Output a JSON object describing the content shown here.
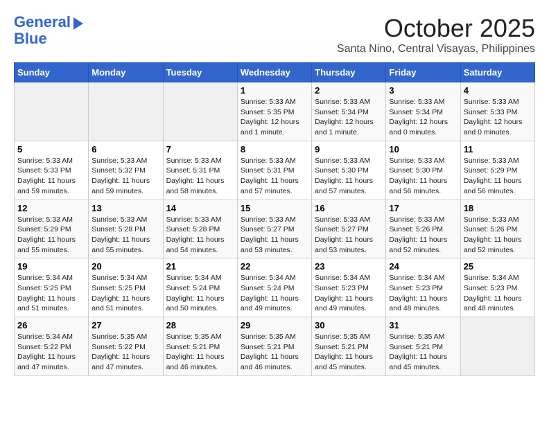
{
  "header": {
    "logo_line1": "General",
    "logo_line2": "Blue",
    "month": "October 2025",
    "location": "Santa Nino, Central Visayas, Philippines"
  },
  "days_of_week": [
    "Sunday",
    "Monday",
    "Tuesday",
    "Wednesday",
    "Thursday",
    "Friday",
    "Saturday"
  ],
  "weeks": [
    [
      {
        "day": "",
        "info": ""
      },
      {
        "day": "",
        "info": ""
      },
      {
        "day": "",
        "info": ""
      },
      {
        "day": "1",
        "info": "Sunrise: 5:33 AM\nSunset: 5:35 PM\nDaylight: 12 hours and 1 minute."
      },
      {
        "day": "2",
        "info": "Sunrise: 5:33 AM\nSunset: 5:34 PM\nDaylight: 12 hours and 1 minute."
      },
      {
        "day": "3",
        "info": "Sunrise: 5:33 AM\nSunset: 5:34 PM\nDaylight: 12 hours and 0 minutes."
      },
      {
        "day": "4",
        "info": "Sunrise: 5:33 AM\nSunset: 5:33 PM\nDaylight: 12 hours and 0 minutes."
      }
    ],
    [
      {
        "day": "5",
        "info": "Sunrise: 5:33 AM\nSunset: 5:33 PM\nDaylight: 11 hours and 59 minutes."
      },
      {
        "day": "6",
        "info": "Sunrise: 5:33 AM\nSunset: 5:32 PM\nDaylight: 11 hours and 59 minutes."
      },
      {
        "day": "7",
        "info": "Sunrise: 5:33 AM\nSunset: 5:31 PM\nDaylight: 11 hours and 58 minutes."
      },
      {
        "day": "8",
        "info": "Sunrise: 5:33 AM\nSunset: 5:31 PM\nDaylight: 11 hours and 57 minutes."
      },
      {
        "day": "9",
        "info": "Sunrise: 5:33 AM\nSunset: 5:30 PM\nDaylight: 11 hours and 57 minutes."
      },
      {
        "day": "10",
        "info": "Sunrise: 5:33 AM\nSunset: 5:30 PM\nDaylight: 11 hours and 56 minutes."
      },
      {
        "day": "11",
        "info": "Sunrise: 5:33 AM\nSunset: 5:29 PM\nDaylight: 11 hours and 56 minutes."
      }
    ],
    [
      {
        "day": "12",
        "info": "Sunrise: 5:33 AM\nSunset: 5:29 PM\nDaylight: 11 hours and 55 minutes."
      },
      {
        "day": "13",
        "info": "Sunrise: 5:33 AM\nSunset: 5:28 PM\nDaylight: 11 hours and 55 minutes."
      },
      {
        "day": "14",
        "info": "Sunrise: 5:33 AM\nSunset: 5:28 PM\nDaylight: 11 hours and 54 minutes."
      },
      {
        "day": "15",
        "info": "Sunrise: 5:33 AM\nSunset: 5:27 PM\nDaylight: 11 hours and 53 minutes."
      },
      {
        "day": "16",
        "info": "Sunrise: 5:33 AM\nSunset: 5:27 PM\nDaylight: 11 hours and 53 minutes."
      },
      {
        "day": "17",
        "info": "Sunrise: 5:33 AM\nSunset: 5:26 PM\nDaylight: 11 hours and 52 minutes."
      },
      {
        "day": "18",
        "info": "Sunrise: 5:33 AM\nSunset: 5:26 PM\nDaylight: 11 hours and 52 minutes."
      }
    ],
    [
      {
        "day": "19",
        "info": "Sunrise: 5:34 AM\nSunset: 5:25 PM\nDaylight: 11 hours and 51 minutes."
      },
      {
        "day": "20",
        "info": "Sunrise: 5:34 AM\nSunset: 5:25 PM\nDaylight: 11 hours and 51 minutes."
      },
      {
        "day": "21",
        "info": "Sunrise: 5:34 AM\nSunset: 5:24 PM\nDaylight: 11 hours and 50 minutes."
      },
      {
        "day": "22",
        "info": "Sunrise: 5:34 AM\nSunset: 5:24 PM\nDaylight: 11 hours and 49 minutes."
      },
      {
        "day": "23",
        "info": "Sunrise: 5:34 AM\nSunset: 5:23 PM\nDaylight: 11 hours and 49 minutes."
      },
      {
        "day": "24",
        "info": "Sunrise: 5:34 AM\nSunset: 5:23 PM\nDaylight: 11 hours and 48 minutes."
      },
      {
        "day": "25",
        "info": "Sunrise: 5:34 AM\nSunset: 5:23 PM\nDaylight: 11 hours and 48 minutes."
      }
    ],
    [
      {
        "day": "26",
        "info": "Sunrise: 5:34 AM\nSunset: 5:22 PM\nDaylight: 11 hours and 47 minutes."
      },
      {
        "day": "27",
        "info": "Sunrise: 5:35 AM\nSunset: 5:22 PM\nDaylight: 11 hours and 47 minutes."
      },
      {
        "day": "28",
        "info": "Sunrise: 5:35 AM\nSunset: 5:21 PM\nDaylight: 11 hours and 46 minutes."
      },
      {
        "day": "29",
        "info": "Sunrise: 5:35 AM\nSunset: 5:21 PM\nDaylight: 11 hours and 46 minutes."
      },
      {
        "day": "30",
        "info": "Sunrise: 5:35 AM\nSunset: 5:21 PM\nDaylight: 11 hours and 45 minutes."
      },
      {
        "day": "31",
        "info": "Sunrise: 5:35 AM\nSunset: 5:21 PM\nDaylight: 11 hours and 45 minutes."
      },
      {
        "day": "",
        "info": ""
      }
    ]
  ]
}
